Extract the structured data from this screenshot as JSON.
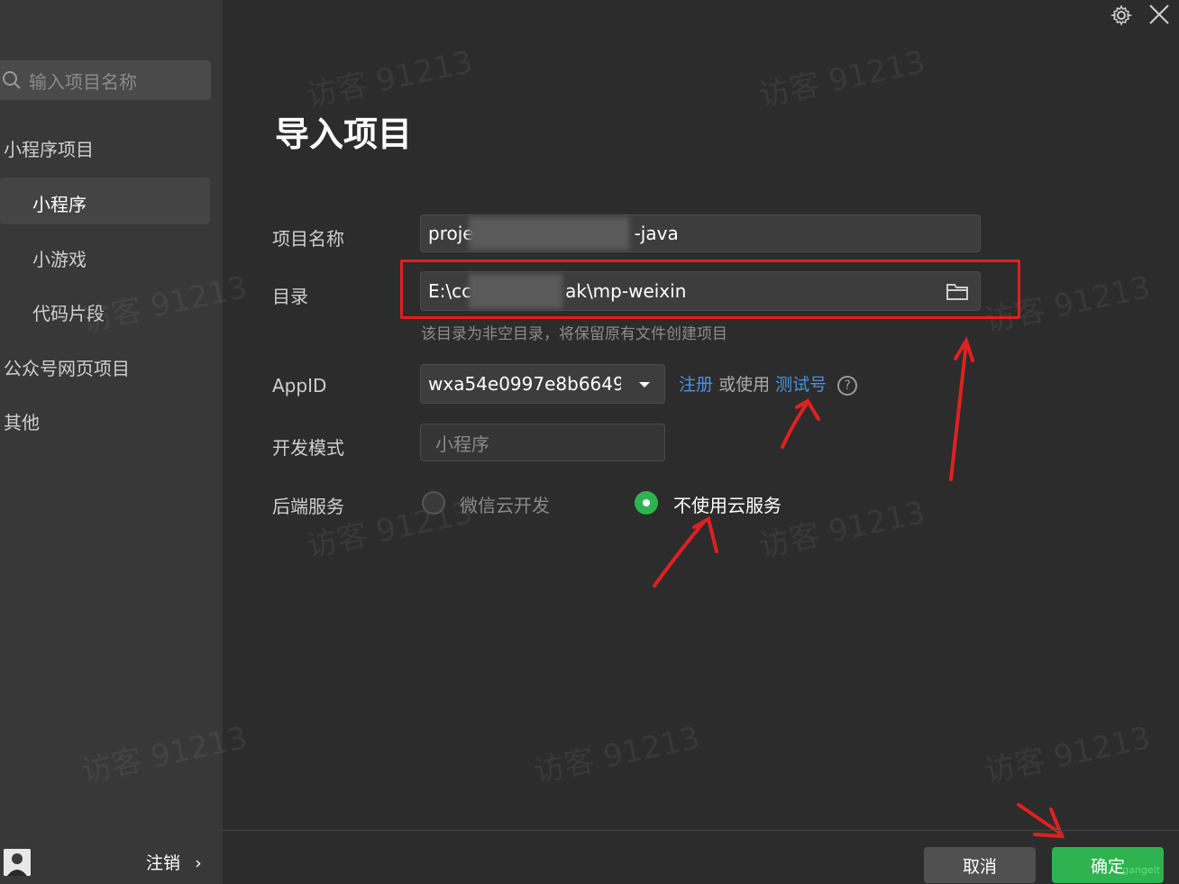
{
  "sidebar": {
    "search_placeholder": "输入项目名称",
    "section_miniprogram": "小程序项目",
    "items": [
      {
        "label": "小程序"
      },
      {
        "label": "小游戏"
      },
      {
        "label": "代码片段"
      }
    ],
    "section_official": "公众号网页项目",
    "section_other": "其他",
    "logout_label": "注销",
    "logout_chevron": "›"
  },
  "main": {
    "title": "导入项目",
    "project_name_label": "项目名称",
    "project_name_value_start": "proje",
    "project_name_value_end": "-java",
    "directory_label": "目录",
    "directory_value_start": "E:\\cc",
    "directory_value_end": "ak\\mp-weixin",
    "directory_hint": "该目录为非空目录，将保留原有文件创建项目",
    "appid_label": "AppID",
    "appid_value": "wxa54e0997e8b6649",
    "register_link": "注册",
    "or_use": "或使用",
    "test_account_link": "测试号",
    "help_symbol": "?",
    "dev_mode_label": "开发模式",
    "dev_mode_value": "小程序",
    "backend_label": "后端服务",
    "backend_options": [
      {
        "label": "微信云开发",
        "selected": false
      },
      {
        "label": "不使用云服务",
        "selected": true
      }
    ]
  },
  "footer": {
    "cancel_label": "取消",
    "confirm_label": "确定",
    "confirm_badge": "gangeit"
  },
  "watermark_text": "访客 91213",
  "colors": {
    "accent_green": "#2fb350",
    "link_blue": "#4a90e2",
    "annotation_red": "#e02020"
  }
}
